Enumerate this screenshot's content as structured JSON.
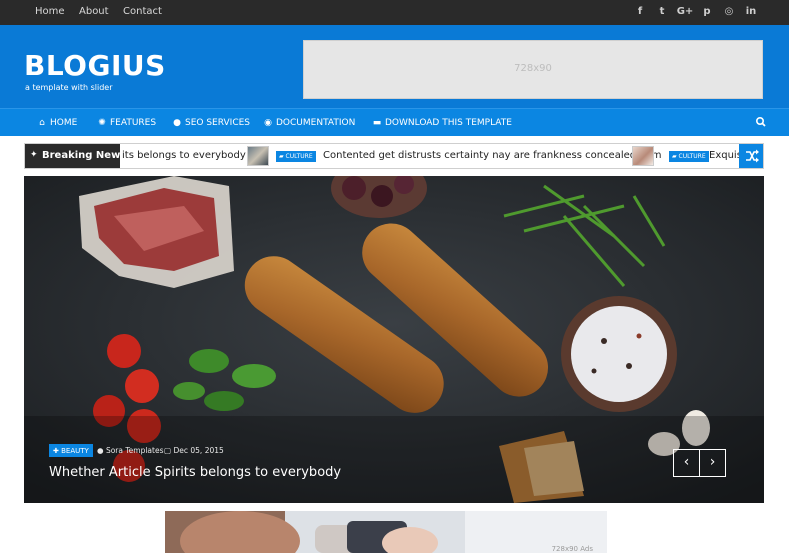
{
  "topbar": {
    "links": [
      "Home",
      "About",
      "Contact"
    ],
    "social": [
      {
        "name": "facebook-icon",
        "glyph": "f"
      },
      {
        "name": "twitter-icon",
        "glyph": "t"
      },
      {
        "name": "google-plus-icon",
        "glyph": "G+"
      },
      {
        "name": "pinterest-icon",
        "glyph": "p"
      },
      {
        "name": "instagram-icon",
        "glyph": "◎"
      },
      {
        "name": "linkedin-icon",
        "glyph": "in"
      }
    ]
  },
  "header": {
    "logo": "BLOGIUS",
    "tagline": "a template with slider",
    "ad_label": "728x90"
  },
  "nav": {
    "items": [
      {
        "label": "HOME",
        "icon": "home-icon",
        "glyph": "⌂"
      },
      {
        "label": "FEATURES",
        "icon": "gear-icon",
        "glyph": "✺"
      },
      {
        "label": "SEO SERVICES",
        "icon": "user-icon",
        "glyph": "●"
      },
      {
        "label": "DOCUMENTATION",
        "icon": "lifebuoy-icon",
        "glyph": "◉"
      },
      {
        "label": "DOWNLOAD THIS TEMPLATE",
        "icon": "download-icon",
        "glyph": "▬"
      }
    ],
    "search_icon": "search-icon"
  },
  "ticker": {
    "label": "Breaking News",
    "items": [
      {
        "text": "its belongs to everybody",
        "category": ""
      },
      {
        "text": "Contented get distrusts certainty nay are frankness concealed ham",
        "category": "CULTURE"
      },
      {
        "text": "Exquis",
        "category": "CULTURE"
      }
    ]
  },
  "slider": {
    "category": "BEAUTY",
    "author": "Sora Templates",
    "date": "Dec 05, 2015",
    "title": "Whether Article Spirits belongs to everybody",
    "prev": "‹",
    "next": "›"
  },
  "bottom_ad": {
    "label": "728x90 Ads"
  },
  "colors": {
    "topbar": "#2a2a2a",
    "header": "#0a7ad6",
    "nav": "#0b86e2",
    "accent": "#0b86e2"
  }
}
